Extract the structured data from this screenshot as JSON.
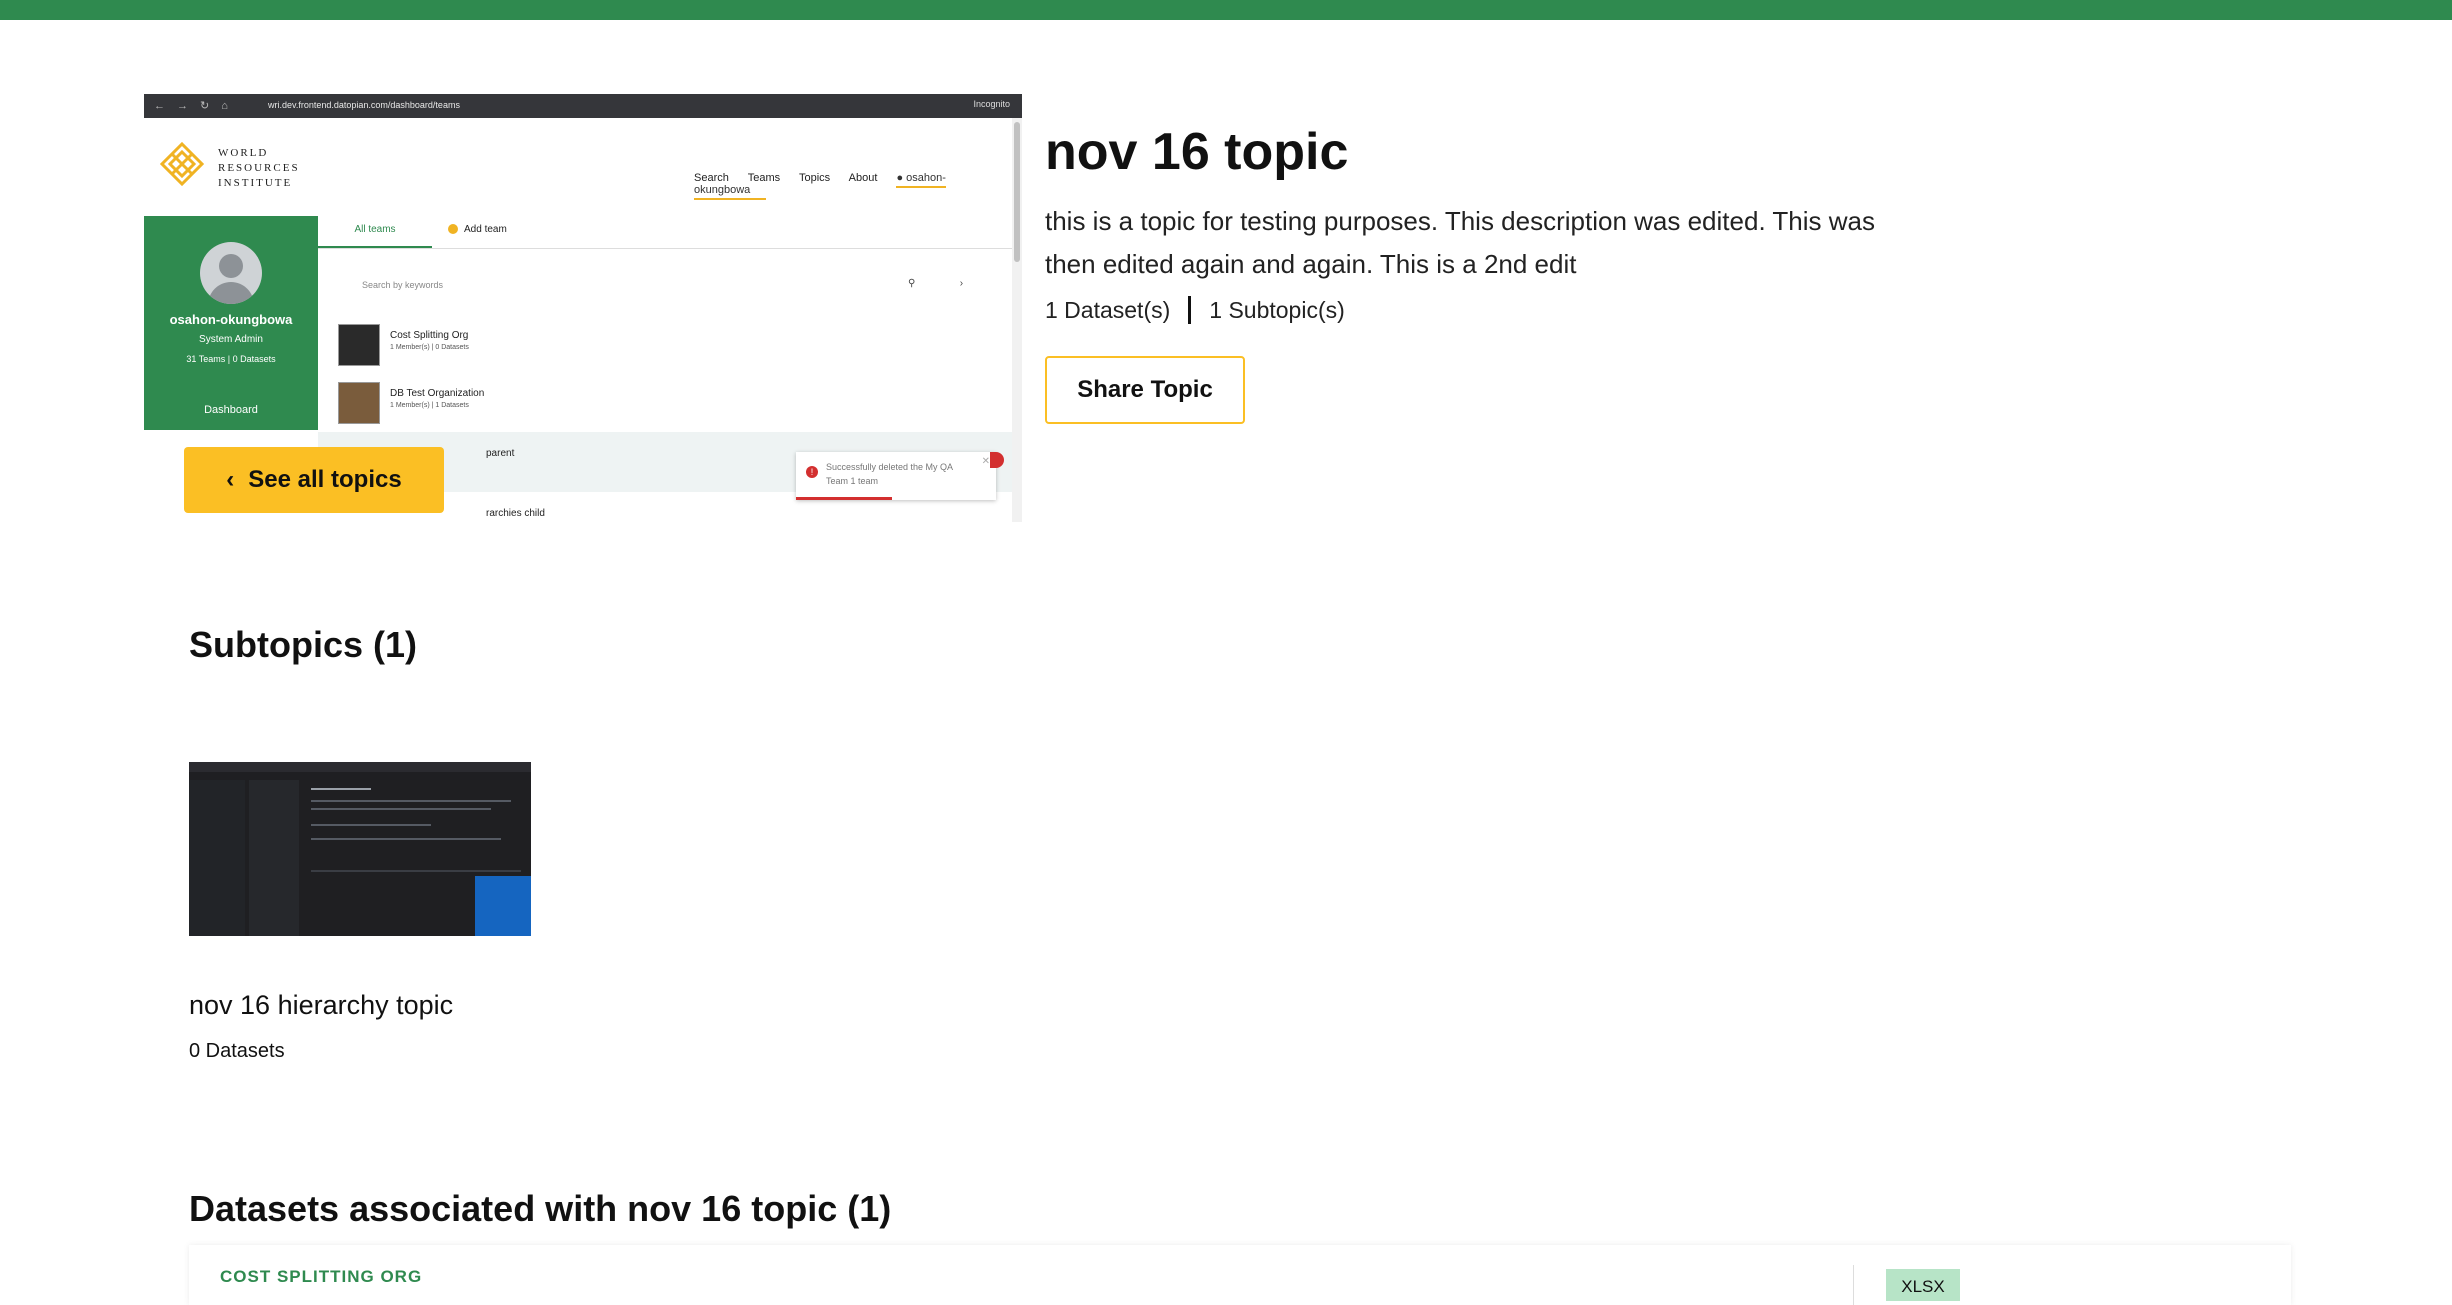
{
  "hero_screenshot": {
    "url": "wri.dev.frontend.datopian.com/dashboard/teams",
    "browser_mode": "Incognito",
    "logo_text": [
      "WORLD",
      "RESOURCES",
      "INSTITUTE"
    ],
    "nav": [
      "Search",
      "Teams",
      "Topics",
      "About"
    ],
    "user": "osahon-okungbowa",
    "profile": {
      "name": "osahon-okungbowa",
      "role": "System Admin",
      "stats": "31 Teams  |  0 Datasets",
      "dashboard": "Dashboard"
    },
    "tabs": [
      "All teams",
      "Add team"
    ],
    "search_placeholder": "Search by keywords",
    "teams": [
      {
        "name": "Cost Splitting Org",
        "meta": "1 Member(s) | 0 Datasets"
      },
      {
        "name": "DB Test Organization",
        "meta": "1 Member(s) | 1 Datasets"
      }
    ],
    "partial_rows": [
      "parent",
      "rarchies child"
    ],
    "toast": "Successfully deleted the My QA Team 1 team"
  },
  "see_all_topics": "See all topics",
  "topic": {
    "title": "nov 16 topic",
    "description": "this is a topic for testing purposes. This description was edited. This was then edited again and again. This is a 2nd edit",
    "datasets_count": "1 Dataset(s)",
    "subtopics_count": "1 Subtopic(s)",
    "share_label": "Share Topic"
  },
  "subtopics": {
    "heading": "Subtopics (1)",
    "items": [
      {
        "name": "nov 16 hierarchy topic",
        "count": "0 Datasets"
      }
    ]
  },
  "datasets": {
    "heading": "Datasets associated with nov 16 topic (1)",
    "items": [
      {
        "org": "COST SPLITTING ORG",
        "format": "XLSX"
      }
    ]
  },
  "colors": {
    "brand_green": "#2f8a4f",
    "accent_yellow": "#fbbf24",
    "format_badge": "#b7e4c7"
  }
}
